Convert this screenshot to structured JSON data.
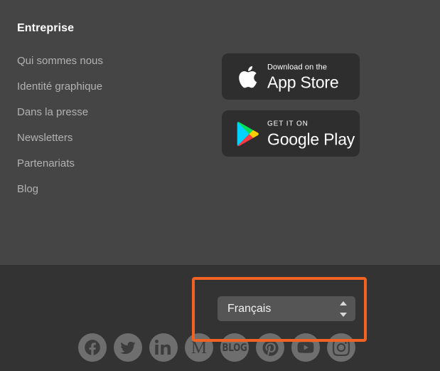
{
  "colors": {
    "upper_background": "#454545",
    "lower_background": "#333333",
    "heading_text": "#ffffff",
    "link_text": "#b2b2b2",
    "badge_background": "#2e2e2e",
    "select_background": "#555555",
    "social_circle": "#6e6e6e",
    "highlight_border": "#f26222"
  },
  "company_column": {
    "heading": "Entreprise",
    "links": [
      {
        "label": "Qui sommes nous",
        "name": "link-qui-sommes-nous"
      },
      {
        "label": "Identité graphique",
        "name": "link-identite-graphique"
      },
      {
        "label": "Dans la presse",
        "name": "link-dans-la-presse"
      },
      {
        "label": "Newsletters",
        "name": "link-newsletters"
      },
      {
        "label": "Partenariats",
        "name": "link-partenariats"
      },
      {
        "label": "Blog",
        "name": "link-blog"
      }
    ]
  },
  "store_badges": {
    "app_store": {
      "icon": "apple-logo-icon",
      "small_text": "Download on the",
      "large_text": "App Store"
    },
    "google_play": {
      "icon": "google-play-logo-icon",
      "small_text": "GET IT ON",
      "large_text": "Google Play"
    }
  },
  "language_selector": {
    "selected": "Français",
    "stepper_up_icon": "triangle-up-icon",
    "stepper_down_icon": "triangle-down-icon",
    "options": [
      "Français"
    ]
  },
  "social_links": [
    {
      "name": "social-facebook",
      "icon": "facebook-icon",
      "label": "Facebook"
    },
    {
      "name": "social-twitter",
      "icon": "twitter-icon",
      "label": "Twitter"
    },
    {
      "name": "social-linkedin",
      "icon": "linkedin-icon",
      "label": "LinkedIn"
    },
    {
      "name": "social-medium",
      "icon": "medium-icon",
      "label": "M"
    },
    {
      "name": "social-blog",
      "icon": "blog-icon",
      "label": "BLOG"
    },
    {
      "name": "social-pinterest",
      "icon": "pinterest-icon",
      "label": "Pinterest"
    },
    {
      "name": "social-youtube",
      "icon": "youtube-icon",
      "label": "YouTube"
    },
    {
      "name": "social-instagram",
      "icon": "instagram-icon",
      "label": "Instagram"
    }
  ]
}
